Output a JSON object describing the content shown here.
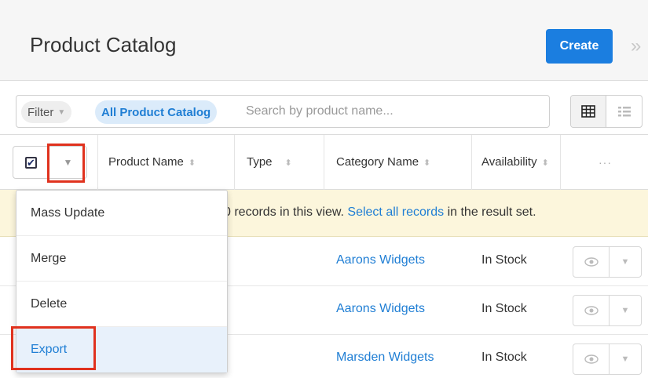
{
  "header": {
    "title": "Product Catalog",
    "create_label": "Create",
    "collapse_glyph": "»"
  },
  "filter": {
    "filter_label": "Filter",
    "module_label": "All Product Catalog",
    "search_placeholder": "Search by product name..."
  },
  "table": {
    "columns": [
      {
        "label": "Product Name",
        "sortable": true
      },
      {
        "label": "Type",
        "sortable": true
      },
      {
        "label": "Category Name",
        "sortable": true
      },
      {
        "label": "Availability",
        "sortable": true
      }
    ],
    "more_columns_glyph": "···",
    "checkbox_glyph": "✔",
    "rows": [
      {
        "category": "Aarons Widgets",
        "availability": "In Stock"
      },
      {
        "category": "Aarons Widgets",
        "availability": "In Stock"
      },
      {
        "category": "Marsden Widgets",
        "availability": "In Stock"
      }
    ]
  },
  "banner": {
    "text_before": "0 records in this view. ",
    "link": "Select all records",
    "text_after": " in the result set."
  },
  "mass_actions_menu": {
    "items": [
      "Mass Update",
      "Merge",
      "Delete",
      "Export"
    ],
    "highlighted": "Export"
  },
  "colors": {
    "accent": "#1b7ee0",
    "link": "#1f7ed4",
    "highlight_box": "#e0321e",
    "banner_bg": "#fcf6dc"
  }
}
